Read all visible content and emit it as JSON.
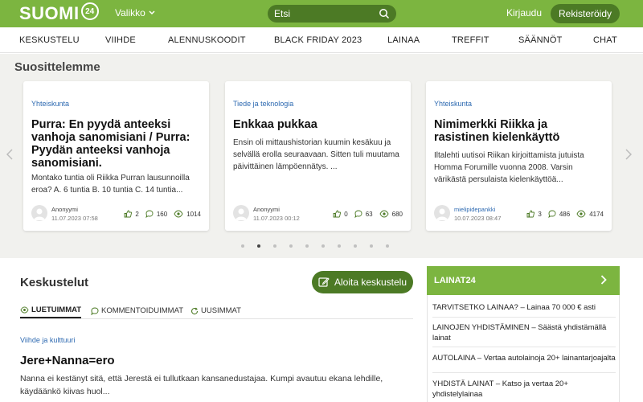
{
  "header": {
    "logo_text": "SUOMI",
    "logo_badge": "24",
    "menu_label": "Valikko",
    "search_placeholder": "Etsi",
    "login_label": "Kirjaudu",
    "register_label": "Rekisteröidy"
  },
  "nav": {
    "items": [
      "KESKUSTELU",
      "VIIHDE",
      "ALENNUSKOODIT",
      "BLACK FRIDAY 2023",
      "LAINAA",
      "TREFFIT",
      "SÄÄNNÖT",
      "CHAT"
    ]
  },
  "featured": {
    "title": "Suosittelemme",
    "cards": [
      {
        "category": "Yhteiskunta",
        "title": "Purra: En pyydä anteeksi vanhoja sanomisiani / Purra: Pyydän anteeksi vanhoja sanomisiani.",
        "excerpt": "Montako tuntia oli Riikka Purran lausunnoilla eroa? A. 6 tuntia B. 10 tuntia C. 14 tuntia...",
        "author": "Anonyymi",
        "date": "11.07.2023 07:58",
        "likes": "2",
        "comments": "160",
        "views": "1014"
      },
      {
        "category": "Tiede ja teknologia",
        "title": "Enkkaa pukkaa",
        "excerpt": "Ensin oli mittaushistorian kuumin kesäkuu ja selvällä erolla seuraavaan. Sitten tuli muutama päivittäinen lämpöennätys. ...",
        "author": "Anonyymi",
        "date": "11.07.2023 00:12",
        "likes": "0",
        "comments": "63",
        "views": "680"
      },
      {
        "category": "Yhteiskunta",
        "title": "Nimimerkki Riikka ja rasistinen kielenkäyttö",
        "excerpt": "Iltalehti uutisoi Riikan kirjoittamista jutuista Homma Forumille vuonna 2008. Varsin värikästä persulaista kielenkäyttöä...",
        "author": "mielipidepankki",
        "date": "10.07.2023 08:47",
        "likes": "3",
        "comments": "486",
        "views": "4174"
      }
    ],
    "page_count": 10,
    "active_page": 2
  },
  "discussions": {
    "title": "Keskustelut",
    "start_label": "Aloita keskustelu",
    "tabs": [
      "LUETUIMMAT",
      "KOMMENTOIDUIMMAT",
      "UUSIMMAT"
    ],
    "post": {
      "category": "Viihde ja kulttuuri",
      "title": "Jere+Nanna=ero",
      "excerpt": "Nanna ei kestänyt sitä, että Jerestä ei tullutkaan kansanedustajaa. Kumpi avautuu ekana lehdille, käydäänkö kiivas huol..."
    }
  },
  "panel": {
    "title": "LAINAT24",
    "items": [
      "TARVITSETKO LAINAA? – Lainaa 70 000 € asti",
      "LAINOJEN YHDISTÄMINEN – Säästä yhdistämällä lainat",
      "AUTOLAINA – Vertaa autolainoja 20+ lainantarjoajalta",
      "YHDISTÄ LAINAT – Katso ja vertaa 20+ yhdistelylainaa"
    ]
  },
  "colors": {
    "brand_green": "#7cb540",
    "dark_green": "#4c7a25",
    "link_blue": "#2e6ab1"
  }
}
